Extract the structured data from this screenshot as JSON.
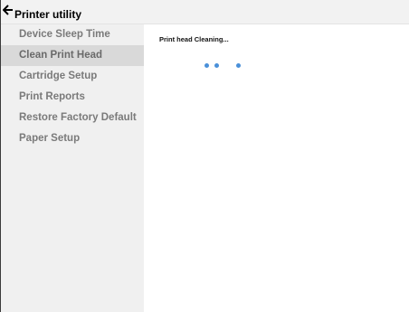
{
  "window": {
    "title": "Printer utility"
  },
  "sidebar": {
    "items": [
      {
        "label": "Device Sleep Time",
        "active": false
      },
      {
        "label": "Clean Print Head",
        "active": true
      },
      {
        "label": "Cartridge Setup",
        "active": false
      },
      {
        "label": "Print Reports",
        "active": false
      },
      {
        "label": "Restore Factory Default",
        "active": false
      },
      {
        "label": "Paper Setup",
        "active": false
      }
    ]
  },
  "main": {
    "status_text": "Print head Cleaning..."
  },
  "icons": {
    "back": "back-arrow-icon",
    "spinner": "loading-spinner-icon"
  },
  "colors": {
    "accent": "#4a90d9",
    "sidebar_bg": "#f0f0f0",
    "active_item_bg": "#d9d9d9"
  }
}
